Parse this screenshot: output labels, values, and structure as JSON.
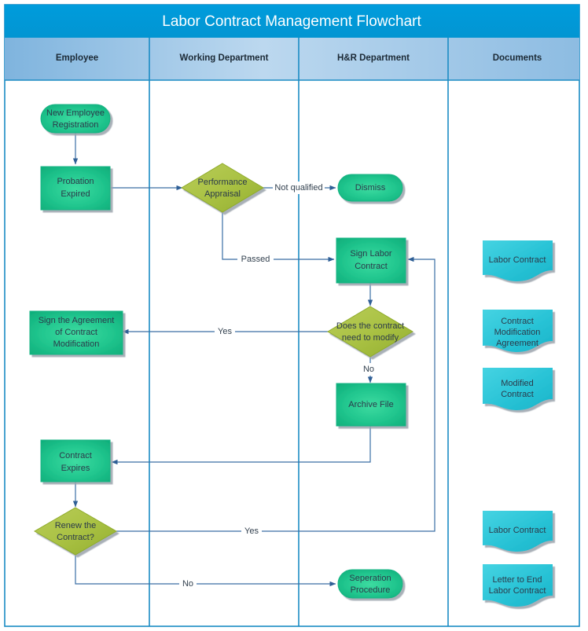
{
  "title": "Labor Contract Management Flowchart",
  "colors": {
    "title_bar": "#0099d8",
    "lane_header": "#a8cbe8",
    "frame_border": "#1b8cc4",
    "process_green": "#1ec48c",
    "decision_olive": "#a8bf45",
    "document_cyan": "#2ec6d8",
    "connector": "#3a6ea5",
    "text_dark": "#2b3a4a"
  },
  "lanes": [
    {
      "label": "Employee"
    },
    {
      "label": "Working Department"
    },
    {
      "label": "H&R Department"
    },
    {
      "label": "Documents"
    }
  ],
  "nodes": [
    {
      "id": "new-employee-registration",
      "label": "New Employee Registration",
      "shape": "terminator",
      "lane": "Employee"
    },
    {
      "id": "probation-expired",
      "label": "Probation Expired",
      "shape": "process",
      "lane": "Employee"
    },
    {
      "id": "performance-appraisal",
      "label": "Performance Appraisal",
      "shape": "decision",
      "lane": "Working Department"
    },
    {
      "id": "dismiss",
      "label": "Dismiss",
      "shape": "terminator",
      "lane": "H&R Department"
    },
    {
      "id": "sign-labor-contract",
      "label": "Sign Labor Contract",
      "shape": "process",
      "lane": "H&R Department"
    },
    {
      "id": "does-the-contract-need-to-modify",
      "label": "Does the contract need to modify",
      "shape": "decision",
      "lane": "H&R Department"
    },
    {
      "id": "sign-the-agreement-of-contract-modification",
      "label": "Sign the Agreement of Contract Modification",
      "shape": "process",
      "lane": "Employee"
    },
    {
      "id": "archive-file",
      "label": "Archive File",
      "shape": "process",
      "lane": "H&R Department"
    },
    {
      "id": "contract-expires",
      "label": "Contract Expires",
      "shape": "process",
      "lane": "Employee"
    },
    {
      "id": "renew-the-contract",
      "label": "Renew the Contract?",
      "shape": "decision",
      "lane": "Employee"
    },
    {
      "id": "seperation-procedure",
      "label": "Seperation Procedure",
      "shape": "terminator",
      "lane": "H&R Department"
    },
    {
      "id": "doc-labor-contract-1",
      "label": "Labor Contract",
      "shape": "document",
      "lane": "Documents"
    },
    {
      "id": "doc-contract-modification-agreement",
      "label": "Contract Modification Agreement",
      "shape": "document",
      "lane": "Documents"
    },
    {
      "id": "doc-modified-contract",
      "label": "Modified Contract",
      "shape": "document",
      "lane": "Documents"
    },
    {
      "id": "doc-labor-contract-2",
      "label": "Labor Contract",
      "shape": "document",
      "lane": "Documents"
    },
    {
      "id": "doc-letter-to-end-labor-contract",
      "label": "Letter to End Labor Contract",
      "shape": "document",
      "lane": "Documents"
    }
  ],
  "node_lines": {
    "new-employee-registration": [
      "New Employee",
      "Registration"
    ],
    "probation-expired": [
      "Probation",
      "Expired"
    ],
    "performance-appraisal": [
      "Performance",
      "Appraisal"
    ],
    "dismiss": [
      "Dismiss"
    ],
    "sign-labor-contract": [
      "Sign Labor",
      "Contract"
    ],
    "does-the-contract-need-to-modify": [
      "Does the contract",
      "need to modify"
    ],
    "sign-the-agreement-of-contract-modification": [
      "Sign the Agreement",
      "of Contract",
      "Modification"
    ],
    "archive-file": [
      "Archive File"
    ],
    "contract-expires": [
      "Contract",
      "Expires"
    ],
    "renew-the-contract": [
      "Renew the",
      "Contract?"
    ],
    "seperation-procedure": [
      "Seperation",
      "Procedure"
    ],
    "doc-labor-contract-1": [
      "Labor Contract"
    ],
    "doc-contract-modification-agreement": [
      "Contract",
      "Modification",
      "Agreement"
    ],
    "doc-modified-contract": [
      "Modified",
      "Contract"
    ],
    "doc-labor-contract-2": [
      "Labor Contract"
    ],
    "doc-letter-to-end-labor-contract": [
      "Letter to End",
      "Labor Contract"
    ]
  },
  "edge_labels": {
    "not_qualified": "Not qualified",
    "passed": "Passed",
    "yes_modify": "Yes",
    "no_modify": "No",
    "yes_renew": "Yes",
    "no_renew": "No"
  }
}
